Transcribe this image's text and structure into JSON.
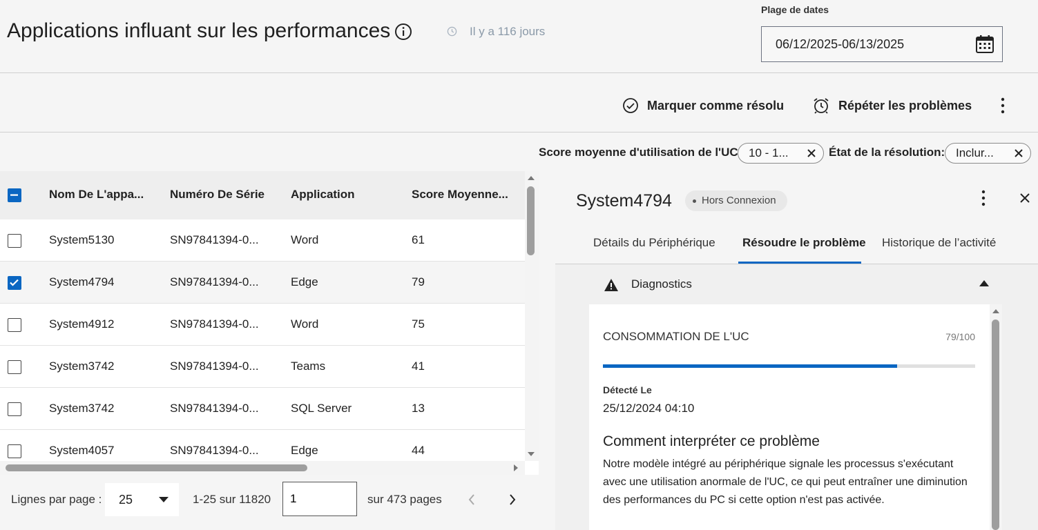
{
  "header": {
    "title": "Applications influant sur les performances",
    "last_updated": "Il y a 116 jours",
    "date_range_label": "Plage de dates",
    "date_range_value": "06/12/2025-06/13/2025"
  },
  "toolbar": {
    "mark_resolved": "Marquer comme résolu",
    "repeat_issues": "Répéter les problèmes"
  },
  "filters": {
    "cpu_score_label": "Score moyenne d'utilisation de l'UC:",
    "cpu_score_value": "10 - 1...",
    "resolution_label": "État de la résolution:",
    "resolution_value": "Inclur..."
  },
  "table": {
    "columns": [
      "Nom De L'appa...",
      "Numéro De Série",
      "Application",
      "Score Moyenne..."
    ],
    "rows": [
      {
        "name": "System5130",
        "serial": "SN97841394-0...",
        "app": "Word",
        "score": "61",
        "checked": false
      },
      {
        "name": "System4794",
        "serial": "SN97841394-0...",
        "app": "Edge",
        "score": "79",
        "checked": true
      },
      {
        "name": "System4912",
        "serial": "SN97841394-0...",
        "app": "Word",
        "score": "75",
        "checked": false
      },
      {
        "name": "System3742",
        "serial": "SN97841394-0...",
        "app": "Teams",
        "score": "41",
        "checked": false
      },
      {
        "name": "System3742",
        "serial": "SN97841394-0...",
        "app": "SQL Server",
        "score": "13",
        "checked": false
      },
      {
        "name": "System4057",
        "serial": "SN97841394-0...",
        "app": "Edge",
        "score": "44",
        "checked": false
      }
    ]
  },
  "pagination": {
    "rows_per_page_label": "Lignes par page :",
    "rows_per_page": "25",
    "range": "1-25 sur 11820",
    "page": "1",
    "of_pages": "sur 473 pages"
  },
  "panel": {
    "device_name": "System4794",
    "status": "Hors Connexion",
    "tabs": [
      "Détails du Périphérique",
      "Résoudre le problème",
      "Historique de l’activité"
    ],
    "active_tab": 1,
    "section_title": "Diagnostics",
    "metric_name": "CONSOMMATION DE L'UC",
    "metric_score": "79/100",
    "metric_fraction": 0.79,
    "detected_label": "Détecté Le",
    "detected_value": "25/12/2024 04:10",
    "howto_title": "Comment interpréter ce problème",
    "howto_body": "Notre modèle intégré au périphérique signale les processus s'exécutant avec une utilisation anormale de l'UC, ce qui peut entraîner une diminution des performances du PC si cette option n'est pas activée."
  },
  "colors": {
    "accent": "#0a66c2",
    "muted_text": "#8a99a8"
  }
}
